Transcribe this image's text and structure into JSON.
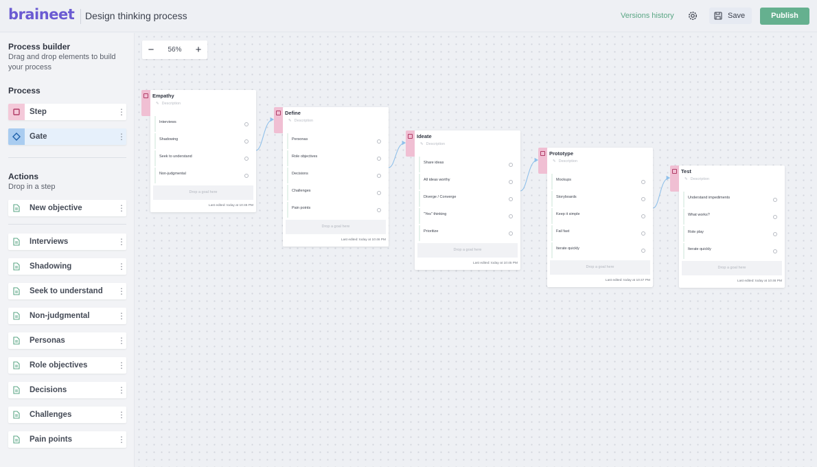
{
  "header": {
    "logo": "braineet",
    "title": "Design thinking process",
    "versions_label": "Versions history",
    "save_label": "Save",
    "publish_label": "Publish"
  },
  "sidebar": {
    "title": "Process builder",
    "subtitle": "Drag and drop elements to build your process",
    "process_heading": "Process",
    "process_items": [
      {
        "label": "Step",
        "icon": "step-square-icon"
      },
      {
        "label": "Gate",
        "icon": "gate-diamond-icon"
      }
    ],
    "actions_heading": "Actions",
    "actions_sub": "Drop in a step",
    "new_objective": "New objective",
    "objectives": [
      "Interviews",
      "Shadowing",
      "Seek to understand",
      "Non-judgmental",
      "Personas",
      "Role objectives",
      "Decisions",
      "Challenges",
      "Pain points"
    ]
  },
  "canvas": {
    "zoom_level": "56%",
    "zoom_out": "−",
    "zoom_in": "+"
  },
  "steps": [
    {
      "title": "Empathy",
      "description": "Description",
      "objectives": [
        "Interviews",
        "Shadowing",
        "Seek to understand",
        "Non-judgmental"
      ],
      "drop_text": "Drop a goal here",
      "last_edited": "Last edited: today at 10:46 PM"
    },
    {
      "title": "Define",
      "description": "Description",
      "objectives": [
        "Personas",
        "Role objectives",
        "Decisions",
        "Challenges",
        "Pain points"
      ],
      "drop_text": "Drop a goal here",
      "last_edited": "Last edited: today at 10:46 PM"
    },
    {
      "title": "Ideate",
      "description": "Description",
      "objectives": [
        "Share ideas",
        "All ideas worthy",
        "Diverge / Converge",
        "\"Yes\" thinking",
        "Prioritize"
      ],
      "drop_text": "Drop a goal here",
      "last_edited": "Last edited: today at 10:45 PM"
    },
    {
      "title": "Prototype",
      "description": "Description",
      "objectives": [
        "Mockups",
        "Storyboards",
        "Keep it simple",
        "Fail fast",
        "Iterate quickly"
      ],
      "drop_text": "Drop a goal here",
      "last_edited": "Last edited: today at 10:47 PM"
    },
    {
      "title": "Test",
      "description": "Description",
      "objectives": [
        "Understand impediments",
        "What works?",
        "Role play",
        "Iterate quickly"
      ],
      "drop_text": "Drop a goal here",
      "last_edited": "Last edited: today at 10:46 PM"
    }
  ],
  "colors": {
    "brand": "#6b5bd2",
    "accent_green": "#65b08f",
    "step_pink": "#f0bfd3",
    "gate_blue": "#a9ccf0",
    "connector": "#8fc0ea"
  }
}
